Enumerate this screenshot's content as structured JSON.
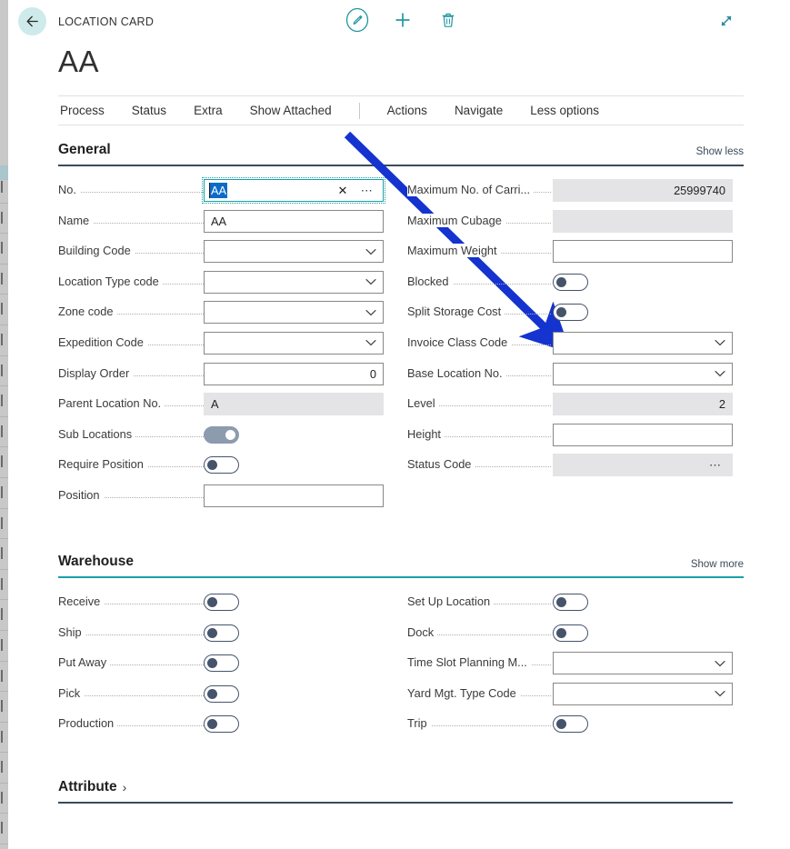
{
  "header": {
    "breadcrumb": "LOCATION CARD",
    "title": "AA",
    "back_icon": "arrow-left-icon",
    "edit_icon": "pencil-edit-icon",
    "new_icon": "plus-new-icon",
    "delete_icon": "trash-delete-icon",
    "expand_icon": "expand-diagonal-icon"
  },
  "action_tabs": [
    {
      "label": "Process"
    },
    {
      "label": "Status"
    },
    {
      "label": "Extra"
    },
    {
      "label": "Show Attached"
    },
    {
      "label": "Actions"
    },
    {
      "label": "Navigate"
    },
    {
      "label": "Less options"
    }
  ],
  "sections": [
    {
      "title": "General",
      "toggle_link": "Show less",
      "left_fields": [
        {
          "label": "No.",
          "type": "focus-lookup",
          "value": "AA",
          "clear_icon": "clear-x-icon",
          "lookup_icon": "ellipsis-lookup-icon"
        },
        {
          "label": "Name",
          "type": "text",
          "value": "AA"
        },
        {
          "label": "Building Code",
          "type": "dropdown",
          "value": "",
          "icon": "chevron-down-icon"
        },
        {
          "label": "Location Type code",
          "type": "dropdown",
          "value": "",
          "icon": "chevron-down-icon"
        },
        {
          "label": "Zone code",
          "type": "dropdown",
          "value": "",
          "icon": "chevron-down-icon"
        },
        {
          "label": "Expedition Code",
          "type": "dropdown",
          "value": "",
          "icon": "chevron-down-icon"
        },
        {
          "label": "Display Order",
          "type": "number",
          "value": "0"
        },
        {
          "label": "Parent Location No.",
          "type": "readonly",
          "value": "A"
        },
        {
          "label": "Sub Locations",
          "type": "toggle",
          "value": "on"
        },
        {
          "label": "Require Position",
          "type": "toggle",
          "value": "off"
        },
        {
          "label": "Position",
          "type": "text",
          "value": ""
        }
      ],
      "right_fields": [
        {
          "label": "Maximum No. of Carri...",
          "type": "readonly-number",
          "value": "25999740"
        },
        {
          "label": "Maximum Cubage",
          "type": "readonly",
          "value": ""
        },
        {
          "label": "Maximum Weight",
          "type": "text",
          "value": ""
        },
        {
          "label": "Blocked",
          "type": "toggle",
          "value": "off"
        },
        {
          "label": "Split Storage Cost",
          "type": "toggle",
          "value": "off"
        },
        {
          "label": "Invoice Class Code",
          "type": "dropdown",
          "value": "",
          "icon": "chevron-down-icon"
        },
        {
          "label": "Base Location No.",
          "type": "dropdown",
          "value": "",
          "icon": "chevron-down-icon"
        },
        {
          "label": "Level",
          "type": "readonly-number",
          "value": "2"
        },
        {
          "label": "Height",
          "type": "text",
          "value": ""
        },
        {
          "label": "Status Code",
          "type": "readonly-lookup",
          "value": "",
          "lookup_icon": "ellipsis-lookup-icon"
        }
      ]
    },
    {
      "title": "Warehouse",
      "toggle_link": "Show more",
      "left_fields": [
        {
          "label": "Receive",
          "type": "toggle",
          "value": "off"
        },
        {
          "label": "Ship",
          "type": "toggle",
          "value": "off"
        },
        {
          "label": "Put Away",
          "type": "toggle",
          "value": "off"
        },
        {
          "label": "Pick",
          "type": "toggle",
          "value": "off"
        },
        {
          "label": "Production",
          "type": "toggle",
          "value": "off"
        }
      ],
      "right_fields": [
        {
          "label": "Set Up Location",
          "type": "toggle",
          "value": "off"
        },
        {
          "label": "Dock",
          "type": "toggle",
          "value": "off"
        },
        {
          "label": "Time Slot Planning M...",
          "type": "dropdown",
          "value": "",
          "icon": "chevron-down-icon"
        },
        {
          "label": "Yard Mgt. Type Code",
          "type": "dropdown",
          "value": "",
          "icon": "chevron-down-icon"
        },
        {
          "label": "Trip",
          "type": "toggle",
          "value": "off"
        }
      ]
    }
  ],
  "attribute_section": {
    "title": "Attribute",
    "chevron": "›",
    "chevron_icon": "chevron-right-icon"
  },
  "annotation": {
    "arrow_icon": "annotation-arrow-icon",
    "color": "#1433cf",
    "points_to": "Invoice Class Code"
  },
  "colors": {
    "accent_teal": "#19a0a8",
    "rule_dark": "#3b4a59",
    "selection_blue": "#0b6bc9",
    "readonly_bg": "#e4e4e6",
    "toggle_dark": "#45546a"
  }
}
